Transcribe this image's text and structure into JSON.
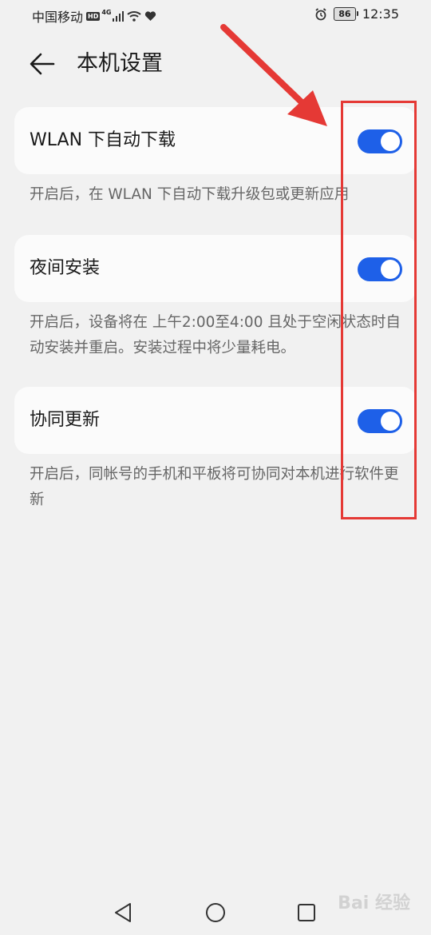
{
  "status_bar": {
    "carrier": "中国移动",
    "hd": "HD",
    "network_type": "4G",
    "battery": "86",
    "time": "12:35"
  },
  "header": {
    "title": "本机设置"
  },
  "settings": [
    {
      "label": "WLAN 下自动下载",
      "enabled": true,
      "description": "开启后，在 WLAN 下自动下载升级包或更新应用"
    },
    {
      "label": "夜间安装",
      "enabled": true,
      "description": "开启后，设备将在 上午2:00至4:00 且处于空闲状态时自动安装并重启。安装过程中将少量耗电。"
    },
    {
      "label": "协同更新",
      "enabled": true,
      "description": "开启后，同帐号的手机和平板将可协同对本机进行软件更新"
    }
  ],
  "colors": {
    "toggle_on": "#1e60e8",
    "annotation": "#e53935",
    "background": "#f1f1f1"
  },
  "watermark": "Bai 经验"
}
